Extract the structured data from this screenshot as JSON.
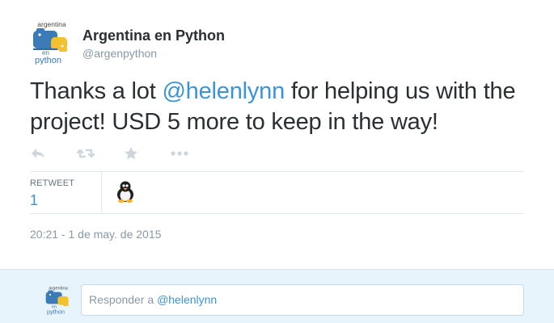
{
  "author": {
    "fullname": "Argentina en Python",
    "username": "@argenpython",
    "logo_text_top": "argentina",
    "logo_text_mid": "en",
    "logo_text_bottom": "python"
  },
  "tweet": {
    "text_before": "Thanks a lot ",
    "mention": "@helenlynn",
    "text_after": " for helping us with the project! USD 5 more to keep in the way!",
    "timestamp": "20:21 - 1 de may. de 2015"
  },
  "actions": [
    {
      "name": "reply-icon"
    },
    {
      "name": "retweet-icon"
    },
    {
      "name": "favorite-icon"
    },
    {
      "name": "more-icon"
    }
  ],
  "stats": {
    "retweet_label": "RETWEET",
    "retweet_count": "1"
  },
  "reply": {
    "prefix": "Responder a ",
    "handle": "@helenlynn"
  },
  "colors": {
    "link": "#3b94d9",
    "text": "#292f33",
    "muted": "#8899a6",
    "icon": "#ccd6dd",
    "reply_bg": "#e8f4fb"
  }
}
